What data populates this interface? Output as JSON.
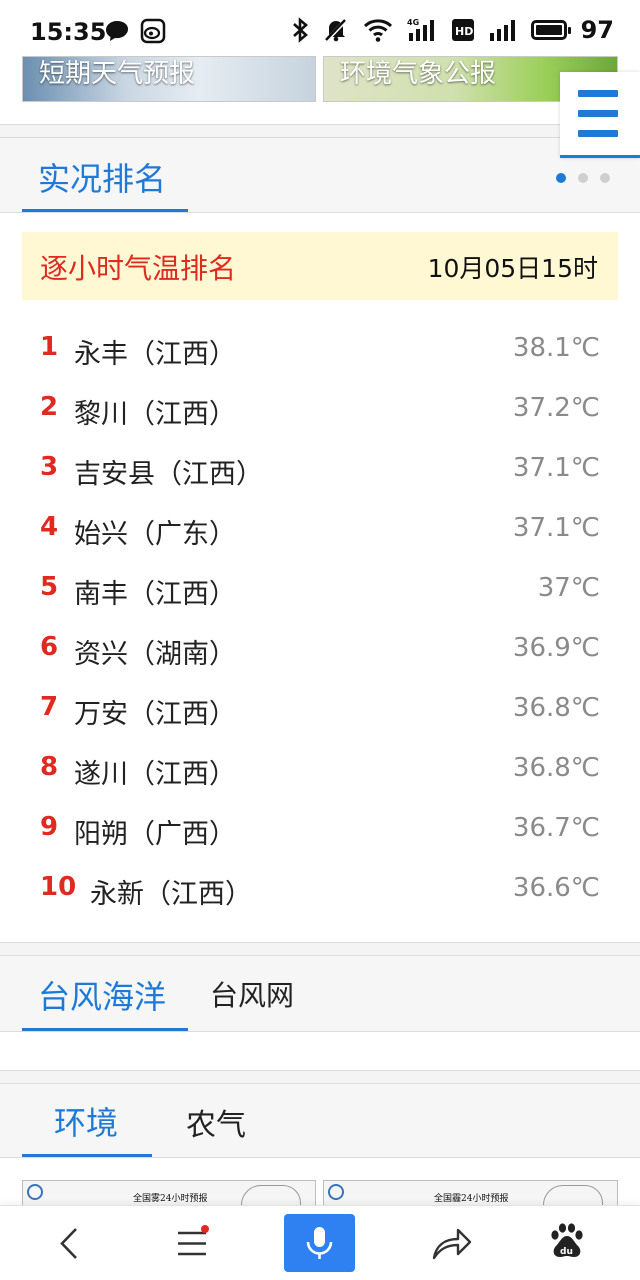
{
  "status_bar": {
    "time": "15:35",
    "battery": "97",
    "icons": [
      "message-icon",
      "weibo-icon",
      "bluetooth-icon",
      "mute-icon",
      "wifi-icon",
      "signal-4g-icon",
      "hd-icon",
      "signal-icon",
      "battery-icon"
    ]
  },
  "top_cards": [
    {
      "label": "短期天气预报"
    },
    {
      "label": "环境气象公报"
    }
  ],
  "live_section": {
    "tab": "实况排名",
    "dots": 3,
    "active_dot": 0
  },
  "ranking": {
    "title": "逐小时气温排名",
    "time": "10月05日15时",
    "items": [
      {
        "rank": "1",
        "name": "永丰（江西）",
        "temp": "38.1℃"
      },
      {
        "rank": "2",
        "name": "黎川（江西）",
        "temp": "37.2℃"
      },
      {
        "rank": "3",
        "name": "吉安县（江西）",
        "temp": "37.1℃"
      },
      {
        "rank": "4",
        "name": "始兴（广东）",
        "temp": "37.1℃"
      },
      {
        "rank": "5",
        "name": "南丰（江西）",
        "temp": "37℃"
      },
      {
        "rank": "6",
        "name": "资兴（湖南）",
        "temp": "36.9℃"
      },
      {
        "rank": "7",
        "name": "万安（江西）",
        "temp": "36.8℃"
      },
      {
        "rank": "8",
        "name": "遂川（江西）",
        "temp": "36.8℃"
      },
      {
        "rank": "9",
        "name": "阳朔（广西）",
        "temp": "36.7℃"
      },
      {
        "rank": "10",
        "name": "永新（江西）",
        "temp": "36.6℃"
      }
    ]
  },
  "typhoon_section": {
    "tabs": [
      "台风海洋",
      "台风网"
    ]
  },
  "env_section": {
    "tabs": [
      "环境",
      "农气"
    ]
  },
  "bottom_cards": [
    {
      "label": "全国雾24小时预报"
    },
    {
      "label": "全国霾24小时预报"
    }
  ],
  "colors": {
    "accent": "#1e7ad6",
    "rank_red": "#e0291f",
    "highlight_bg": "#fff8d2",
    "mic_blue": "#2f80f0"
  }
}
